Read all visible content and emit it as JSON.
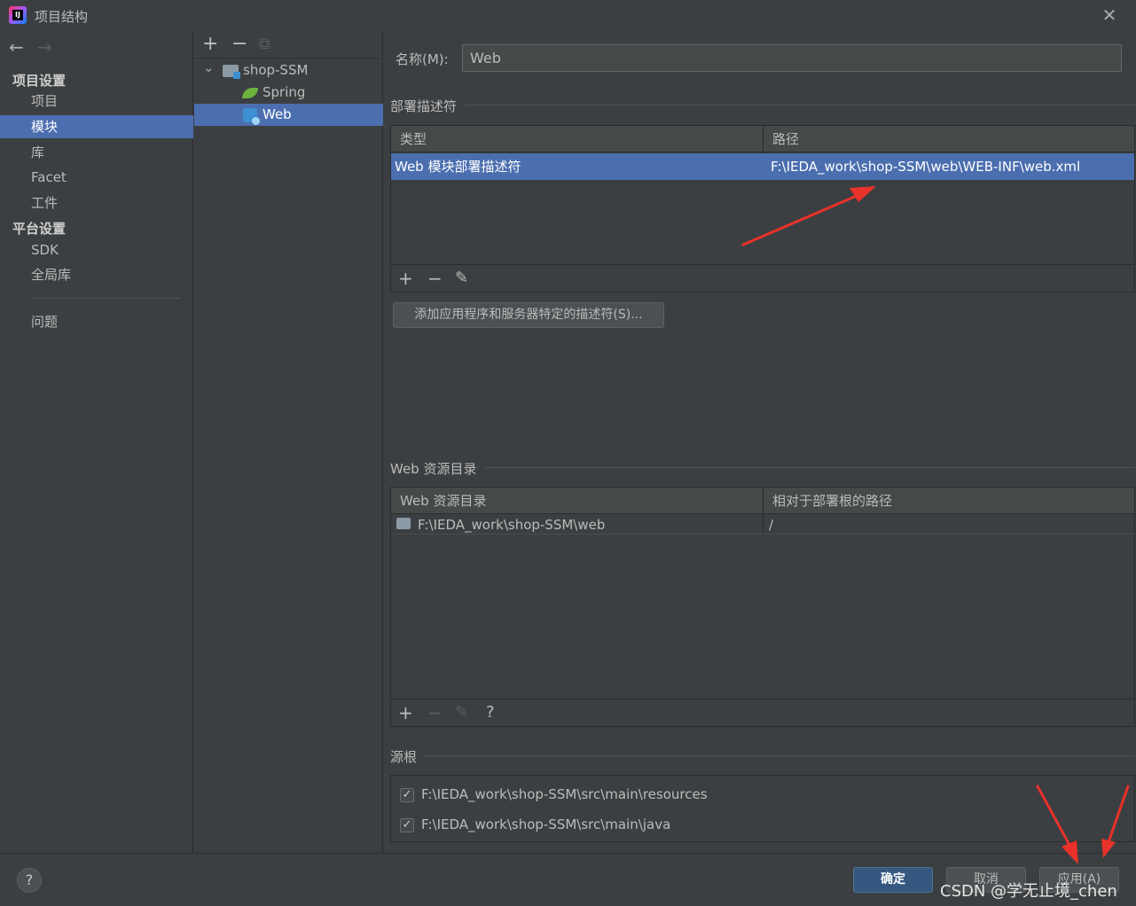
{
  "window": {
    "title": "项目结构",
    "close_glyph": "✕"
  },
  "nav": {
    "back_glyph": "←",
    "forward_glyph": "→",
    "project_settings_heading": "项目设置",
    "project_settings_items": [
      "项目",
      "模块",
      "库",
      "Facet",
      "工件"
    ],
    "selected_item": "模块",
    "platform_settings_heading": "平台设置",
    "platform_settings_items": [
      "SDK",
      "全局库"
    ],
    "problems_item": "问题"
  },
  "tree": {
    "toolbar": {
      "add_glyph": "+",
      "remove_glyph": "−",
      "copy_glyph": "⧉"
    },
    "expand_glyph": "⌄",
    "nodes": [
      {
        "label": "shop-SSM",
        "icon": "module-folder-icon"
      },
      {
        "label": "Spring",
        "icon": "spring-leaf-icon"
      },
      {
        "label": "Web",
        "icon": "web-facet-icon",
        "selected": true
      }
    ]
  },
  "detail": {
    "name_label": "名称(M):",
    "name_value": "Web",
    "deploy_section_title": "部署描述符",
    "deploy_table": {
      "columns": [
        "类型",
        "路径"
      ],
      "rows": [
        {
          "type": "Web 模块部署描述符",
          "path": "F:\\IEDA_work\\shop-SSM\\web\\WEB-INF\\web.xml",
          "selected": true
        }
      ],
      "footer": {
        "add_glyph": "+",
        "remove_glyph": "−",
        "edit_glyph": "✎"
      }
    },
    "add_descriptor_button": "添加应用程序和服务器特定的描述符(S)...",
    "web_resource_section_title": "Web 资源目录",
    "web_resource_table": {
      "columns": [
        "Web 资源目录",
        "相对于部署根的路径"
      ],
      "rows": [
        {
          "dir": "F:\\IEDA_work\\shop-SSM\\web",
          "relative": "/"
        }
      ],
      "footer": {
        "add_glyph": "+",
        "remove_glyph": "−",
        "edit_glyph": "✎",
        "help_glyph": "?"
      }
    },
    "source_roots_section_title": "源根",
    "source_roots": [
      {
        "path": "F:\\IEDA_work\\shop-SSM\\src\\main\\resources",
        "checked": true
      },
      {
        "path": "F:\\IEDA_work\\shop-SSM\\src\\main\\java",
        "checked": true
      }
    ]
  },
  "footer": {
    "help_glyph": "?",
    "ok_button": "确定",
    "cancel_button": "取消",
    "apply_button": "应用(A)",
    "watermark": "CSDN @学无止境_chen"
  },
  "colors": {
    "background": "#3c3f41",
    "selection": "#4b6eaf",
    "primary_button": "#365880",
    "annotation_arrow": "#e8322a"
  }
}
